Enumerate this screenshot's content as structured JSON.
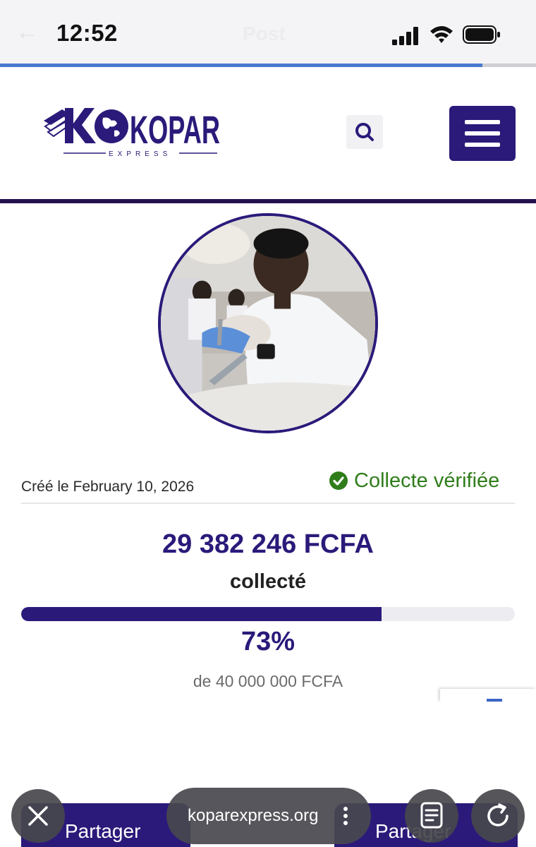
{
  "status_bar": {
    "time": "12:52",
    "ghost_title": "Post"
  },
  "page_load_progress": 0.9,
  "header": {
    "logo_text": "KOPAR",
    "logo_subtext": "EXPRESS"
  },
  "campaign": {
    "created": "Créé le February 10, 2026",
    "verified_label": "Collecte vérifiée",
    "amount_raised": "29 382 246 FCFA",
    "raised_label": "collecté",
    "progress_percent": 73,
    "percent_label": "73%",
    "goal_label": "de 40 000 000 FCFA"
  },
  "bottom_bar": {
    "share_left": "Partager",
    "share_right": "Partager",
    "url": "koparexpress.org"
  },
  "colors": {
    "brand": "#2b1a7a",
    "verified": "#2f7d1a",
    "load_bar": "#4a78d0"
  }
}
